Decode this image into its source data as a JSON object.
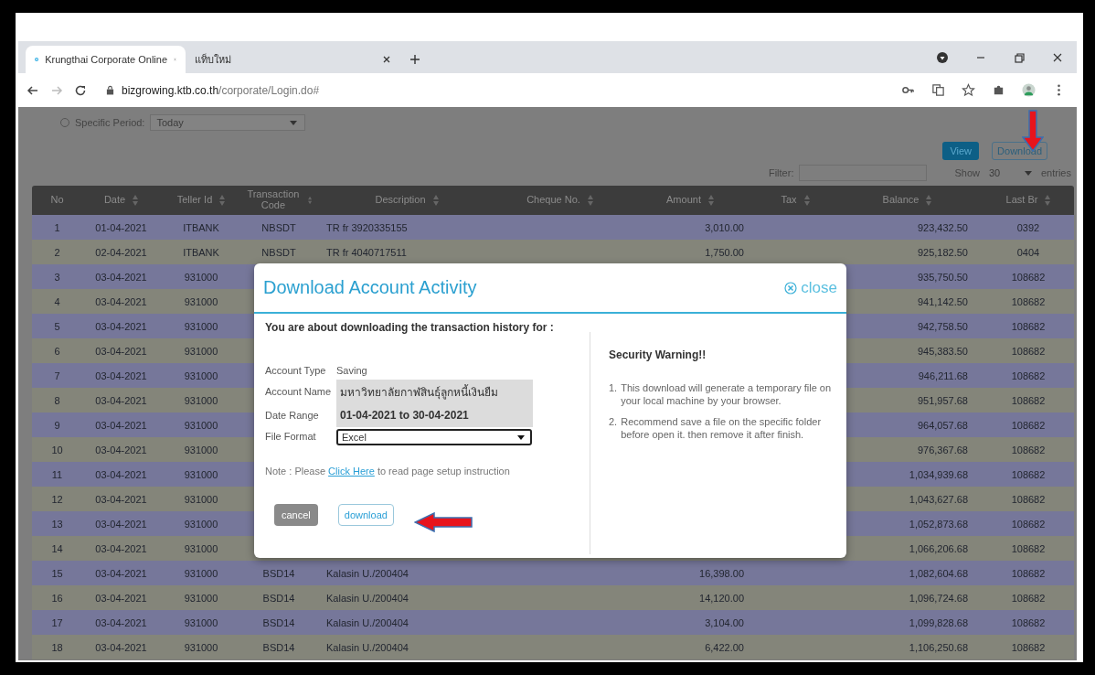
{
  "browser": {
    "tabs": [
      {
        "title": "Krungthai Corporate Online",
        "selected": true
      },
      {
        "title": "แท็บใหม่",
        "selected": false
      }
    ],
    "url_host": "bizgrowing.ktb.co.th",
    "url_path": "/corporate/Login.do#"
  },
  "filters": {
    "period_label": "Specific Period:",
    "period_selected": false,
    "period_value": "Today",
    "view_button": "View",
    "download_button": "Download",
    "filter_label": "Filter:",
    "show_label": "Show",
    "show_value": "30",
    "entries_label": "entries"
  },
  "table": {
    "columns": [
      {
        "label": "No",
        "sortable": false
      },
      {
        "label": "Date",
        "sortable": true
      },
      {
        "label": "Teller Id",
        "sortable": true
      },
      {
        "label": "Transaction Code",
        "sortable": true
      },
      {
        "label": "Description",
        "sortable": true
      },
      {
        "label": "Cheque No.",
        "sortable": true
      },
      {
        "label": "Amount",
        "sortable": true
      },
      {
        "label": "Tax",
        "sortable": true
      },
      {
        "label": "Balance",
        "sortable": true
      },
      {
        "label": "Last Br",
        "sortable": true
      }
    ],
    "rows": [
      {
        "no": "1",
        "date": "01-04-2021",
        "teller": "ITBANK",
        "code": "NBSDT",
        "desc": "TR fr 3920335155",
        "amount": "3,010.00",
        "balance": "923,432.50",
        "branch": "0392"
      },
      {
        "no": "2",
        "date": "02-04-2021",
        "teller": "ITBANK",
        "code": "NBSDT",
        "desc": "TR fr 4040717511",
        "amount": "1,750.00",
        "balance": "925,182.50",
        "branch": "0404"
      },
      {
        "no": "3",
        "date": "03-04-2021",
        "teller": "931000",
        "balance": "935,750.50",
        "branch": "108682"
      },
      {
        "no": "4",
        "date": "03-04-2021",
        "teller": "931000",
        "balance": "941,142.50",
        "branch": "108682"
      },
      {
        "no": "5",
        "date": "03-04-2021",
        "teller": "931000",
        "balance": "942,758.50",
        "branch": "108682"
      },
      {
        "no": "6",
        "date": "03-04-2021",
        "teller": "931000",
        "balance": "945,383.50",
        "branch": "108682"
      },
      {
        "no": "7",
        "date": "03-04-2021",
        "teller": "931000",
        "balance": "946,211.68",
        "branch": "108682"
      },
      {
        "no": "8",
        "date": "03-04-2021",
        "teller": "931000",
        "balance": "951,957.68",
        "branch": "108682"
      },
      {
        "no": "9",
        "date": "03-04-2021",
        "teller": "931000",
        "balance": "964,057.68",
        "branch": "108682"
      },
      {
        "no": "10",
        "date": "03-04-2021",
        "teller": "931000",
        "balance": "976,367.68",
        "branch": "108682"
      },
      {
        "no": "11",
        "date": "03-04-2021",
        "teller": "931000",
        "balance": "1,034,939.68",
        "branch": "108682"
      },
      {
        "no": "12",
        "date": "03-04-2021",
        "teller": "931000",
        "balance": "1,043,627.68",
        "branch": "108682"
      },
      {
        "no": "13",
        "date": "03-04-2021",
        "teller": "931000",
        "balance": "1,052,873.68",
        "branch": "108682"
      },
      {
        "no": "14",
        "date": "03-04-2021",
        "teller": "931000",
        "balance": "1,066,206.68",
        "branch": "108682"
      },
      {
        "no": "15",
        "date": "03-04-2021",
        "teller": "931000",
        "code": "BSD14",
        "desc": "Kalasin U./200404",
        "amount": "16,398.00",
        "balance": "1,082,604.68",
        "branch": "108682"
      },
      {
        "no": "16",
        "date": "03-04-2021",
        "teller": "931000",
        "code": "BSD14",
        "desc": "Kalasin U./200404",
        "amount": "14,120.00",
        "balance": "1,096,724.68",
        "branch": "108682"
      },
      {
        "no": "17",
        "date": "03-04-2021",
        "teller": "931000",
        "code": "BSD14",
        "desc": "Kalasin U./200404",
        "amount": "3,104.00",
        "balance": "1,099,828.68",
        "branch": "108682"
      },
      {
        "no": "18",
        "date": "03-04-2021",
        "teller": "931000",
        "code": "BSD14",
        "desc": "Kalasin U./200404",
        "amount": "6,422.00",
        "balance": "1,106,250.68",
        "branch": "108682"
      }
    ]
  },
  "modal": {
    "title": "Download Account Activity",
    "close_label": "close",
    "intro": "You are about downloading the transaction history for :",
    "fields": [
      {
        "label": "Account Type",
        "value": "Saving",
        "kind": "plain"
      },
      {
        "label": "Account Name",
        "value": "มหาวิทยาลัยกาฬสินธุ์ลูกหนี้เงินยืม",
        "kind": "boxed"
      },
      {
        "label": "Date Range",
        "value": "01-04-2021 to 30-04-2021",
        "kind": "boxed"
      },
      {
        "label": "File Format",
        "value": "Excel",
        "kind": "select"
      }
    ],
    "note_before": "Note : Please",
    "note_link": "Click Here",
    "note_after": "to read page setup instruction",
    "cancel_button": "cancel",
    "download_button": "download",
    "warning_title": "Security Warning!!",
    "warnings": [
      {
        "number": "1.",
        "text": "This download will generate a temporary file on your local machine by your browser."
      },
      {
        "number": "2.",
        "text": "Recommend save a file on the specific folder before open it. then remove it after finish."
      }
    ]
  },
  "annotations": [
    {
      "kind": "down"
    },
    {
      "kind": "left"
    }
  ]
}
